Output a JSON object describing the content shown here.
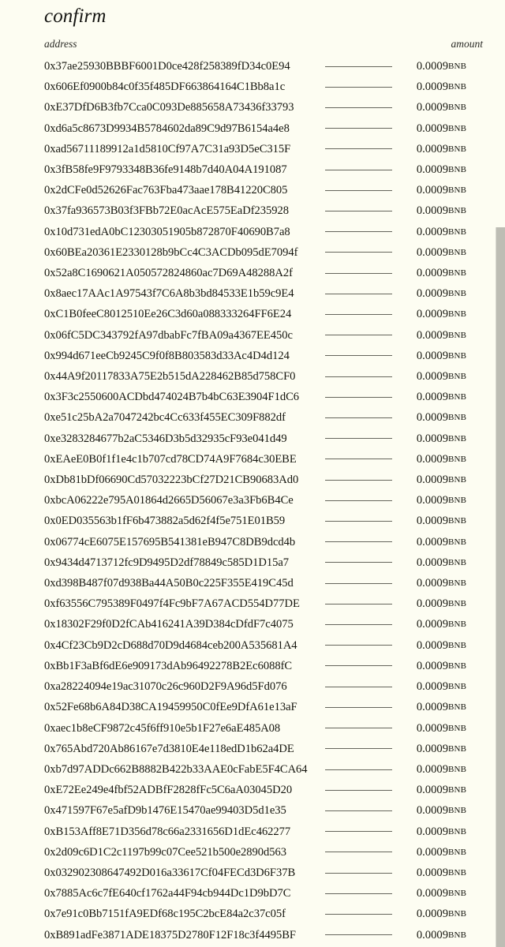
{
  "page": {
    "title": "confirm",
    "background_color": "#fdfdf2",
    "text_color": "#16160f"
  },
  "table": {
    "headers": {
      "address": "address",
      "amount": "amount"
    },
    "unit": "BNB",
    "default_amount": "0.0009",
    "rows": [
      {
        "address": "0x37ae25930BBBF6001D0ce428f258389fD34c0E94",
        "amount": "0.0009",
        "unit": "BNB"
      },
      {
        "address": "0x606Ef0900b84c0f35f485DF663864164C1Bb8a1c",
        "amount": "0.0009",
        "unit": "BNB"
      },
      {
        "address": "0xE37DfD6B3fb7Cca0C093De885658A73436f33793",
        "amount": "0.0009",
        "unit": "BNB"
      },
      {
        "address": "0xd6a5c8673D9934B5784602da89C9d97B6154a4e8",
        "amount": "0.0009",
        "unit": "BNB"
      },
      {
        "address": "0xad56711189912a1d5810Cf97A7C31a93D5eC315F",
        "amount": "0.0009",
        "unit": "BNB"
      },
      {
        "address": "0x3fB58fe9F9793348B36fe9148b7d40A04A191087",
        "amount": "0.0009",
        "unit": "BNB"
      },
      {
        "address": "0x2dCFe0d52626Fac763Fba473aae178B41220C805",
        "amount": "0.0009",
        "unit": "BNB"
      },
      {
        "address": "0x37fa936573B03f3FBb72E0acAcE575EaDf235928",
        "amount": "0.0009",
        "unit": "BNB"
      },
      {
        "address": "0x10d731edA0bC12303051905b872870F40690B7a8",
        "amount": "0.0009",
        "unit": "BNB"
      },
      {
        "address": "0x60BEa20361E2330128b9bCc4C3ACDb095dE7094f",
        "amount": "0.0009",
        "unit": "BNB"
      },
      {
        "address": "0x52a8C1690621A050572824860ac7D69A48288A2f",
        "amount": "0.0009",
        "unit": "BNB"
      },
      {
        "address": "0x8aec17AAc1A97543f7C6A8b3bd84533E1b59c9E4",
        "amount": "0.0009",
        "unit": "BNB"
      },
      {
        "address": "0xC1B0feeC8012510Ee26C3d60a088333264FF6E24",
        "amount": "0.0009",
        "unit": "BNB"
      },
      {
        "address": "0x06fC5DC343792fA97dbabFc7fBA09a4367EE450c",
        "amount": "0.0009",
        "unit": "BNB"
      },
      {
        "address": "0x994d671eeCb9245C9f0f8B803583d33Ac4D4d124",
        "amount": "0.0009",
        "unit": "BNB"
      },
      {
        "address": "0x44A9f20117833A75E2b515dA228462B85d758CF0",
        "amount": "0.0009",
        "unit": "BNB"
      },
      {
        "address": "0x3F3c2550600ACDbd474024B7b4bC63E3904F1dC6",
        "amount": "0.0009",
        "unit": "BNB"
      },
      {
        "address": "0xe51c25bA2a7047242bc4Cc633f455EC309F882df",
        "amount": "0.0009",
        "unit": "BNB"
      },
      {
        "address": "0xe3283284677b2aC5346D3b5d32935cF93e041d49",
        "amount": "0.0009",
        "unit": "BNB"
      },
      {
        "address": "0xEAeE0B0f1f1e4c1b707cd78CD74A9F7684c30EBE",
        "amount": "0.0009",
        "unit": "BNB"
      },
      {
        "address": "0xDb81bDf06690Cd57032223bCf27D21CB90683Ad0",
        "amount": "0.0009",
        "unit": "BNB"
      },
      {
        "address": "0xbcA06222e795A01864d2665D56067e3a3Fb6B4Ce",
        "amount": "0.0009",
        "unit": "BNB"
      },
      {
        "address": "0x0ED035563b1fF6b473882a5d62f4f5e751E01B59",
        "amount": "0.0009",
        "unit": "BNB"
      },
      {
        "address": "0x06774cE6075E157695B541381eB947C8DB9dcd4b",
        "amount": "0.0009",
        "unit": "BNB"
      },
      {
        "address": "0x9434d4713712fc9D9495D2df78849c585D1D15a7",
        "amount": "0.0009",
        "unit": "BNB"
      },
      {
        "address": "0xd398B487f07d938Ba44A50B0c225F355E419C45d",
        "amount": "0.0009",
        "unit": "BNB"
      },
      {
        "address": "0xf63556C795389F0497f4Fc9bF7A67ACD554D77DE",
        "amount": "0.0009",
        "unit": "BNB"
      },
      {
        "address": "0x18302F29f0D2fCAb416241A39D384cDfdF7c4075",
        "amount": "0.0009",
        "unit": "BNB"
      },
      {
        "address": "0x4Cf23Cb9D2cD688d70D9d4684ceb200A535681A4",
        "amount": "0.0009",
        "unit": "BNB"
      },
      {
        "address": "0xBb1F3aBf6dE6e909173dAb96492278B2Ec6088fC",
        "amount": "0.0009",
        "unit": "BNB"
      },
      {
        "address": "0xa28224094e19ac31070c26c960D2F9A96d5Fd076",
        "amount": "0.0009",
        "unit": "BNB"
      },
      {
        "address": "0x52Fe68b6A84D38CA19459950C0fEe9DfA61e13aF",
        "amount": "0.0009",
        "unit": "BNB"
      },
      {
        "address": "0xaec1b8eCF9872c45f6ff910e5b1F27e6aE485A08",
        "amount": "0.0009",
        "unit": "BNB"
      },
      {
        "address": "0x765Abd720Ab86167e7d3810E4e118edD1b62a4DE",
        "amount": "0.0009",
        "unit": "BNB"
      },
      {
        "address": "0xb7d97ADDc662B8882B422b33AAE0cFabE5F4CA64",
        "amount": "0.0009",
        "unit": "BNB"
      },
      {
        "address": "0xE72Ee249e4fbf52ADBfF2828fFc5C6aA03045D20",
        "amount": "0.0009",
        "unit": "BNB"
      },
      {
        "address": "0x471597F67e5afD9b1476E15470ae99403D5d1e35",
        "amount": "0.0009",
        "unit": "BNB"
      },
      {
        "address": "0xB153Aff8E71D356d78c66a2331656D1dEc462277",
        "amount": "0.0009",
        "unit": "BNB"
      },
      {
        "address": "0x2d09c6D1C2c1197b99c07Cee521b500e2890d563",
        "amount": "0.0009",
        "unit": "BNB"
      },
      {
        "address": "0x032902308647492D016a33617Cf04FECd3D6F37B",
        "amount": "0.0009",
        "unit": "BNB"
      },
      {
        "address": "0x7885Ac6c7fE640cf1762a44F94cb944Dc1D9bD7C",
        "amount": "0.0009",
        "unit": "BNB"
      },
      {
        "address": "0x7e91c0Bb7151fA9EDf68c195C2bcE84a2c37c05f",
        "amount": "0.0009",
        "unit": "BNB"
      },
      {
        "address": "0xB891adFe3871ADE18375D2780F12F18c3f4495BF",
        "amount": "0.0009",
        "unit": "BNB"
      }
    ]
  },
  "scrollbar": {
    "orientation": "vertical",
    "thumb_color": "#bdbdb4"
  }
}
